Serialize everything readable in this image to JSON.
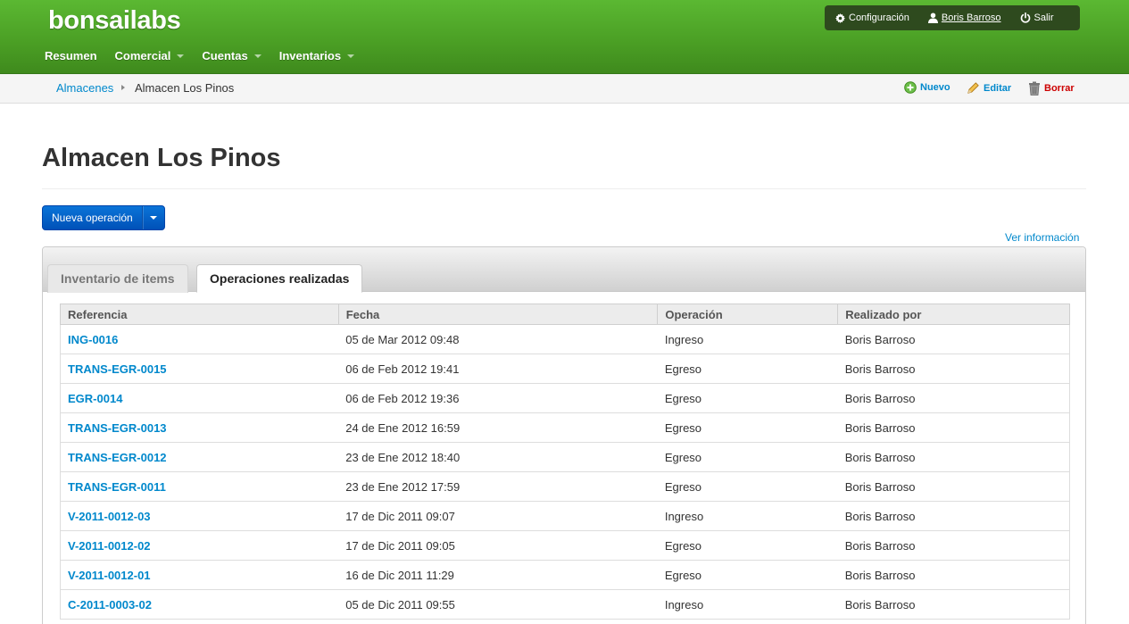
{
  "brand": "bonsailabs",
  "nav": {
    "items": [
      {
        "label": "Resumen",
        "dropdown": false
      },
      {
        "label": "Comercial",
        "dropdown": true
      },
      {
        "label": "Cuentas",
        "dropdown": true
      },
      {
        "label": "Inventarios",
        "dropdown": true
      }
    ]
  },
  "user_menu": {
    "config": "Configuración",
    "user": "Boris Barroso",
    "logout": "Salir"
  },
  "breadcrumb": {
    "parent": "Almacenes",
    "current": "Almacen Los Pinos"
  },
  "actions": {
    "new": "Nuevo",
    "edit": "Editar",
    "delete": "Borrar"
  },
  "page": {
    "title": "Almacen Los Pinos",
    "new_operation": "Nueva operación",
    "more_info": "Ver información"
  },
  "tabs": [
    {
      "label": "Inventario de items",
      "active": false
    },
    {
      "label": "Operaciones realizadas",
      "active": true
    }
  ],
  "table": {
    "headers": [
      "Referencia",
      "Fecha",
      "Operación",
      "Realizado por"
    ],
    "rows": [
      [
        "ING-0016",
        "05 de Mar 2012 09:48",
        "Ingreso",
        "Boris Barroso"
      ],
      [
        "TRANS-EGR-0015",
        "06 de Feb 2012 19:41",
        "Egreso",
        "Boris Barroso"
      ],
      [
        "EGR-0014",
        "06 de Feb 2012 19:36",
        "Egreso",
        "Boris Barroso"
      ],
      [
        "TRANS-EGR-0013",
        "24 de Ene 2012 16:59",
        "Egreso",
        "Boris Barroso"
      ],
      [
        "TRANS-EGR-0012",
        "23 de Ene 2012 18:40",
        "Egreso",
        "Boris Barroso"
      ],
      [
        "TRANS-EGR-0011",
        "23 de Ene 2012 17:59",
        "Egreso",
        "Boris Barroso"
      ],
      [
        "V-2011-0012-03",
        "17 de Dic 2011 09:07",
        "Ingreso",
        "Boris Barroso"
      ],
      [
        "V-2011-0012-02",
        "17 de Dic 2011 09:05",
        "Egreso",
        "Boris Barroso"
      ],
      [
        "V-2011-0012-01",
        "16 de Dic 2011 11:29",
        "Egreso",
        "Boris Barroso"
      ],
      [
        "C-2011-0003-02",
        "05 de Dic 2011 09:55",
        "Ingreso",
        "Boris Barroso"
      ]
    ]
  },
  "colors": {
    "header_green": "#4a9e24",
    "link_blue": "#0088cc",
    "delete_red": "#cc0000",
    "primary_button": "#0a74d8"
  }
}
